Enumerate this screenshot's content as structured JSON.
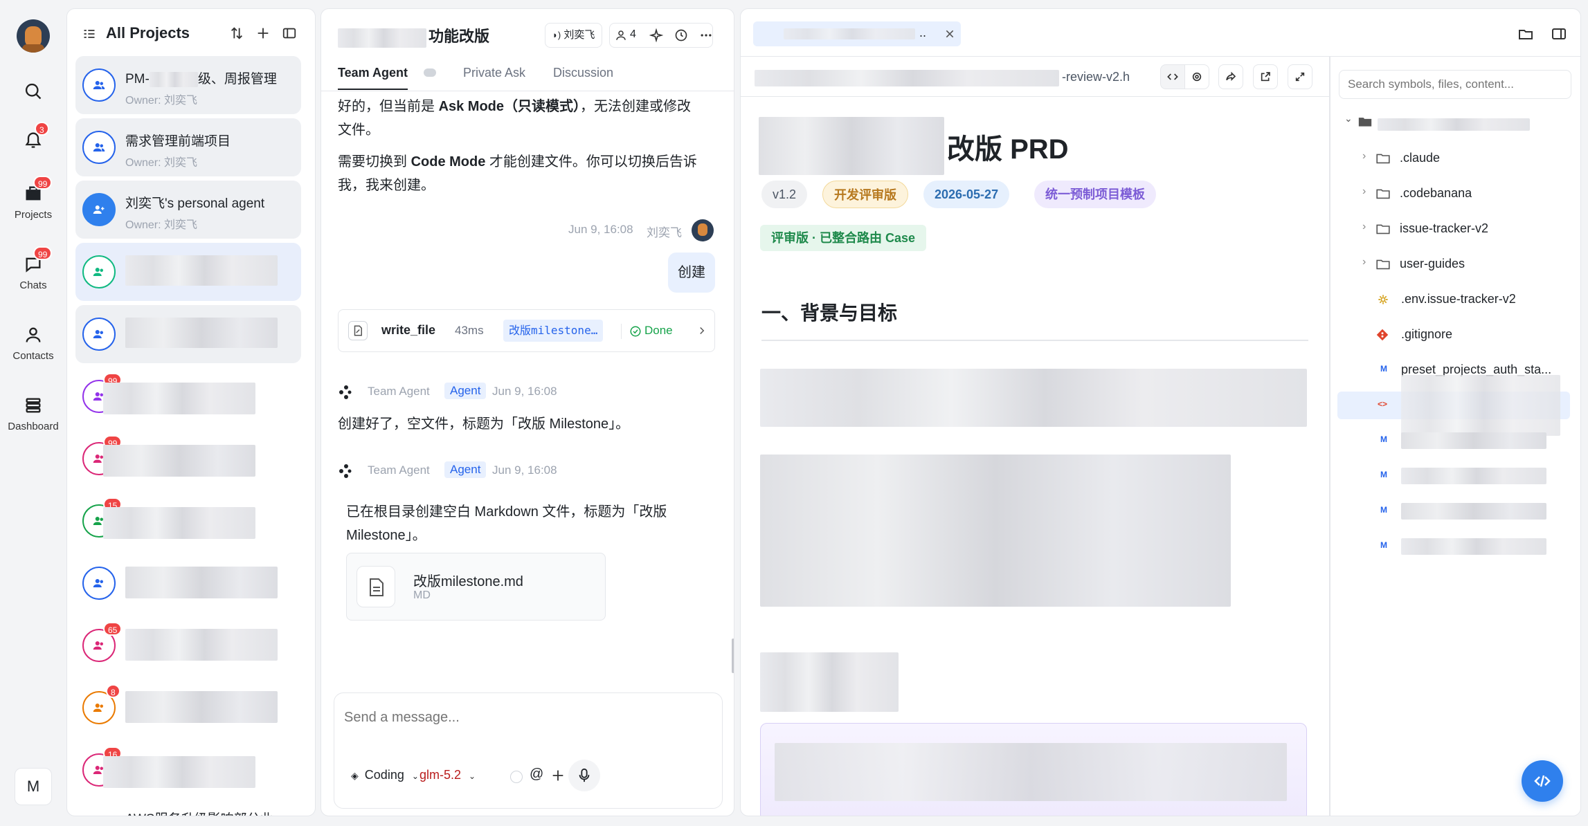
{
  "rail": {
    "badges": {
      "notifications": "3",
      "projects": "99",
      "chats": "99"
    },
    "items": [
      {
        "label": "Projects"
      },
      {
        "label": "Chats"
      },
      {
        "label": "Contacts"
      },
      {
        "label": "Dashboard"
      }
    ],
    "bottom_letter": "M"
  },
  "project_list": {
    "title": "All Projects",
    "items": [
      {
        "name": "PM-",
        "name_tail": "级、周报管理",
        "owner": "Owner: 刘奕飞",
        "color": "#2563eb"
      },
      {
        "name": "需求管理前端项目",
        "owner": "Owner: 刘奕飞",
        "color": "#2563eb"
      },
      {
        "name": "刘奕飞's personal agent",
        "owner": "Owner: 刘奕飞",
        "color": "#2563eb"
      }
    ],
    "badges": [
      "99",
      "99",
      "15",
      "65",
      "8",
      "16"
    ],
    "bottom_name": "AWS服务升级影响部分业..."
  },
  "chat": {
    "title_suffix": "功能改版",
    "user_chip": "刘奕飞",
    "member_count": "4",
    "tabs": [
      {
        "label": "Team Agent"
      },
      {
        "label": "Private Ask"
      },
      {
        "label": "Discussion"
      }
    ],
    "msg1_line1_a": "好的，但当前是 ",
    "msg1_line1_b": "Ask Mode（只读模式）",
    "msg1_line1_c": "，无法创建或修改",
    "msg1_line2": "文件。",
    "msg1_line3_a": "需要切换到 ",
    "msg1_line3_b": "Code Mode",
    "msg1_line3_c": " 才能创建文件。你可以切换后告诉",
    "msg1_line4": "我，我来创建。",
    "user_meta": "Jun 9, 16:08",
    "user_name": "刘奕飞",
    "user_bubble": "创建",
    "tool": {
      "name": "write_file",
      "time": "43ms",
      "file": "改版milestone…",
      "status": "Done"
    },
    "agent_name": "Team Agent",
    "agent_tag": "Agent",
    "agent_time": "Jun 9, 16:08",
    "agent_msg1": "创建好了，空文件，标题为「改版 Milestone」。",
    "agent_msg2_line1": "已在根目录创建空白 Markdown 文件，标题为「改版",
    "agent_msg2_line2": "Milestone」。",
    "file_card": {
      "name": "改版milestone.md",
      "type": "MD"
    },
    "input_placeholder": "Send a message...",
    "mode": "Coding",
    "model": "glm-5.2",
    "at_symbol": "@"
  },
  "preview": {
    "tab_suffix": "..",
    "file_path_suffix": "-review-v2.h",
    "doc_title": "改版 PRD",
    "pills": [
      {
        "label": "v1.2",
        "bg": "#f0f1f3",
        "fg": "#4b5563"
      },
      {
        "label": "开发评审版",
        "bg": "#fdf3dc",
        "fg": "#b7791f"
      },
      {
        "label": "2026-05-27",
        "bg": "#e6f0fd",
        "fg": "#2b6cb0"
      },
      {
        "label": "统一预制项目模板",
        "bg": "#efeafd",
        "fg": "#7c5cd6"
      }
    ],
    "green_pill": "评审版 · 已整合路由 Case",
    "section_title": "一、背景与目标",
    "search_placeholder": "Search symbols, files, content...",
    "tree": [
      {
        "label": ".claude"
      },
      {
        "label": ".codebanana"
      },
      {
        "label": "issue-tracker-v2"
      },
      {
        "label": "user-guides"
      },
      {
        "label": ".env.issue-tracker-v2"
      },
      {
        "label": ".gitignore"
      },
      {
        "label": "preset_projects_auth_sta..."
      }
    ],
    "md_letter": "M",
    "html_icon": "<>"
  },
  "colors": {
    "accent": "#2f80ed",
    "badge": "#ef4444"
  }
}
